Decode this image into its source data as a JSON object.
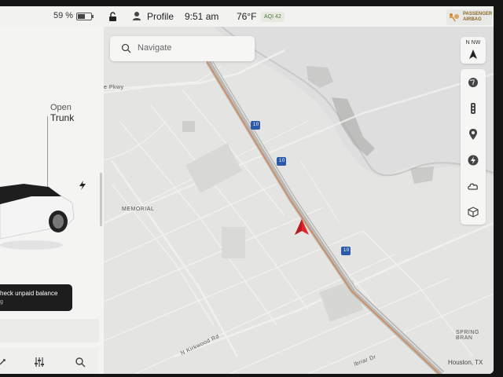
{
  "status_bar": {
    "battery_percent": "59 %",
    "battery_level": 0.59,
    "profile_label": "Profile",
    "time": "9:51 am",
    "temperature": "76°F",
    "aqi": "AQI 42",
    "airbag_line1": "PASSENGER",
    "airbag_line2": "AIRBAG"
  },
  "left_panel": {
    "trunk_line1": "Open",
    "trunk_line2": "Trunk",
    "toast_title": "heck unpaid balance",
    "toast_sub": "g"
  },
  "map": {
    "search_placeholder": "Navigate",
    "compass_heading": "N  NW",
    "labels": {
      "memorial": "MEMORIAL",
      "pkwy": "e Pkwy",
      "kirkwood": "N Kirkwood Rd",
      "spring_branch": "SPRING BRAN",
      "briar": "lbriar Dr",
      "highway_shield": "10"
    },
    "city": "Houston, TX"
  },
  "colors": {
    "highway": "#b8b8b6",
    "highway_accent": "#e07a3a",
    "nav_arrow": "#e0242a",
    "shield": "#2d5aa8"
  },
  "icons": {
    "controls": [
      "globe-icon",
      "traffic-icon",
      "pin-icon",
      "supercharger-icon",
      "weather-icon",
      "3d-cube-icon"
    ],
    "bottom_bar": [
      "controls-icon",
      "sliders-icon",
      "search-icon"
    ]
  }
}
